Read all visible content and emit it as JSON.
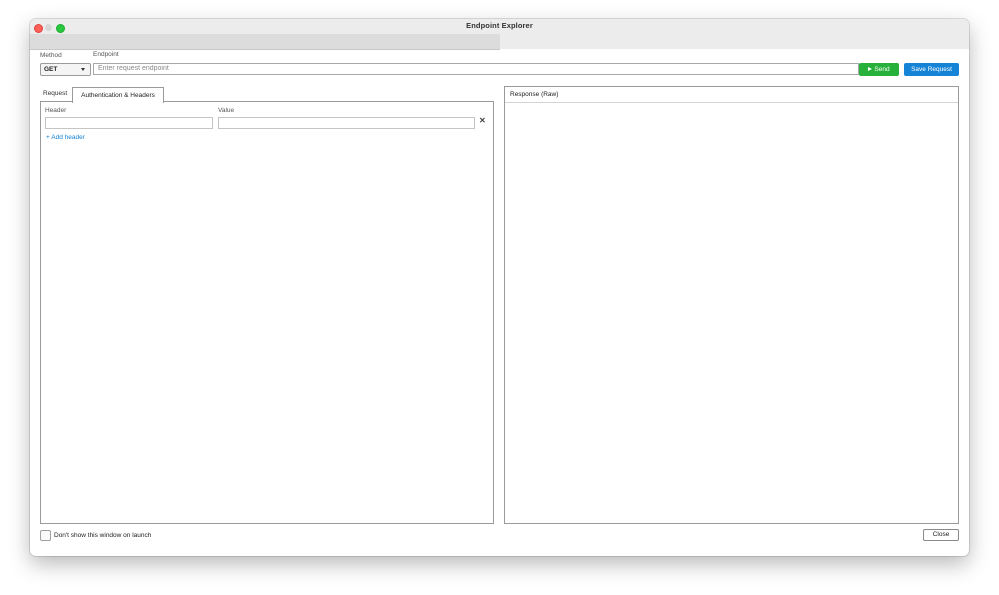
{
  "window": {
    "title": "Endpoint Explorer"
  },
  "request_bar": {
    "method_label": "Method",
    "method_value": "GET",
    "endpoint_label": "Endpoint",
    "endpoint_placeholder": "Enter request endpoint",
    "endpoint_value": "",
    "send_label": "Send",
    "save_label": "Save Request"
  },
  "tabs": [
    {
      "label": "Request",
      "active": false
    },
    {
      "label": "Authentication & Headers",
      "active": true
    }
  ],
  "headers_panel": {
    "header_col": "Header",
    "value_col": "Value",
    "rows": [
      {
        "header": "",
        "value": ""
      }
    ],
    "remove_glyph": "✕",
    "add_label": "+ Add header"
  },
  "response_panel": {
    "title": "Response (Raw)",
    "body": ""
  },
  "footer": {
    "dont_show_label": "Don't show this window on launch",
    "dont_show_checked": false,
    "close_label": "Close"
  },
  "colors": {
    "send": "#27b13a",
    "save": "#1583d6",
    "link": "#1583d6"
  }
}
